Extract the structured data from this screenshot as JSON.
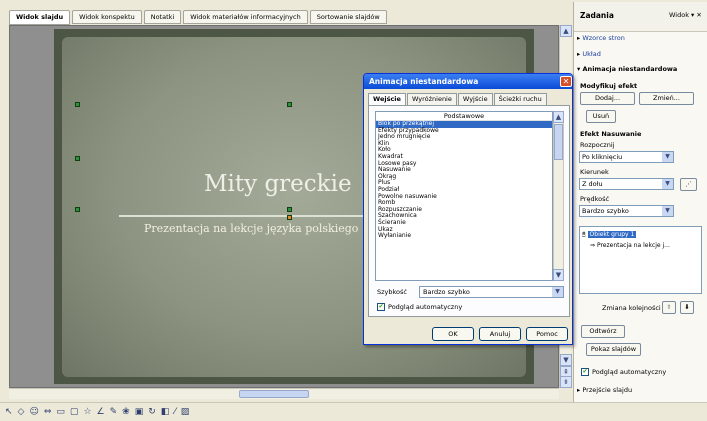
{
  "view_tabs": [
    "Widok slajdu",
    "Widok konspektu",
    "Notatki",
    "Widok materiałów informacyjnych",
    "Sortowanie slajdów"
  ],
  "slide": {
    "title": "Mity greckie",
    "subtitle": "Prezentacja na lekcje języka polskiego"
  },
  "dialog": {
    "title": "Animacja niestandardowa",
    "close": "✕",
    "tabs": [
      "Wejście",
      "Wyróżnienie",
      "Wyjście",
      "Ścieżki ruchu"
    ],
    "list_group": "Podstawowe",
    "effects": [
      "Blok po przekątnej",
      "Efekty przypadkowe",
      "Jedno mrugnięcie",
      "Klin",
      "Koło",
      "Kwadrat",
      "Losowe pasy",
      "Nasuwanie",
      "Okrąg",
      "Plus",
      "Podział",
      "Powolne nasuwanie",
      "Romb",
      "Rozpuszczanie",
      "Szachownica",
      "Ścieranie",
      "Ukaz",
      "Wyłanianie"
    ],
    "selected_index": 0,
    "speed_label": "Szybkość",
    "speed_value": "Bardzo szybko",
    "autopreview": "Podgląd automatyczny",
    "ok": "OK",
    "cancel": "Anuluj",
    "help": "Pomoc"
  },
  "task_pane": {
    "title": "Zadania",
    "view_menu": "Widok ▾ ✕",
    "link1": "Wzorce stron",
    "link2": "Układ",
    "section": "Animacja niestandardowa",
    "modify_header": "Modyfikuj efekt",
    "btn_add": "Dodaj...",
    "btn_change": "Zmień...",
    "btn_remove": "Usuń",
    "effect_header": "Efekt Nasuwanie",
    "start_label": "Rozpocznij",
    "start_value": "Po kliknięciu",
    "direction_label": "Kierunek",
    "direction_value": "Z dołu",
    "speed_label": "Prędkość",
    "speed_value": "Bardzo szybko",
    "list_item1": "Obiekt grupy 1",
    "list_item2": "Prezentacja na lekcje j...",
    "reorder_label": "Zmiana kolejności",
    "btn_play": "Odtwórz",
    "btn_slideshow": "Pokaz slajdów",
    "autopreview": "Podgląd automatyczny",
    "transition": "Przejście slajdu"
  },
  "colors": {
    "titlebar": "#0a4bd7",
    "selection": "#316ac5",
    "slide_bg": "#8c9481"
  }
}
